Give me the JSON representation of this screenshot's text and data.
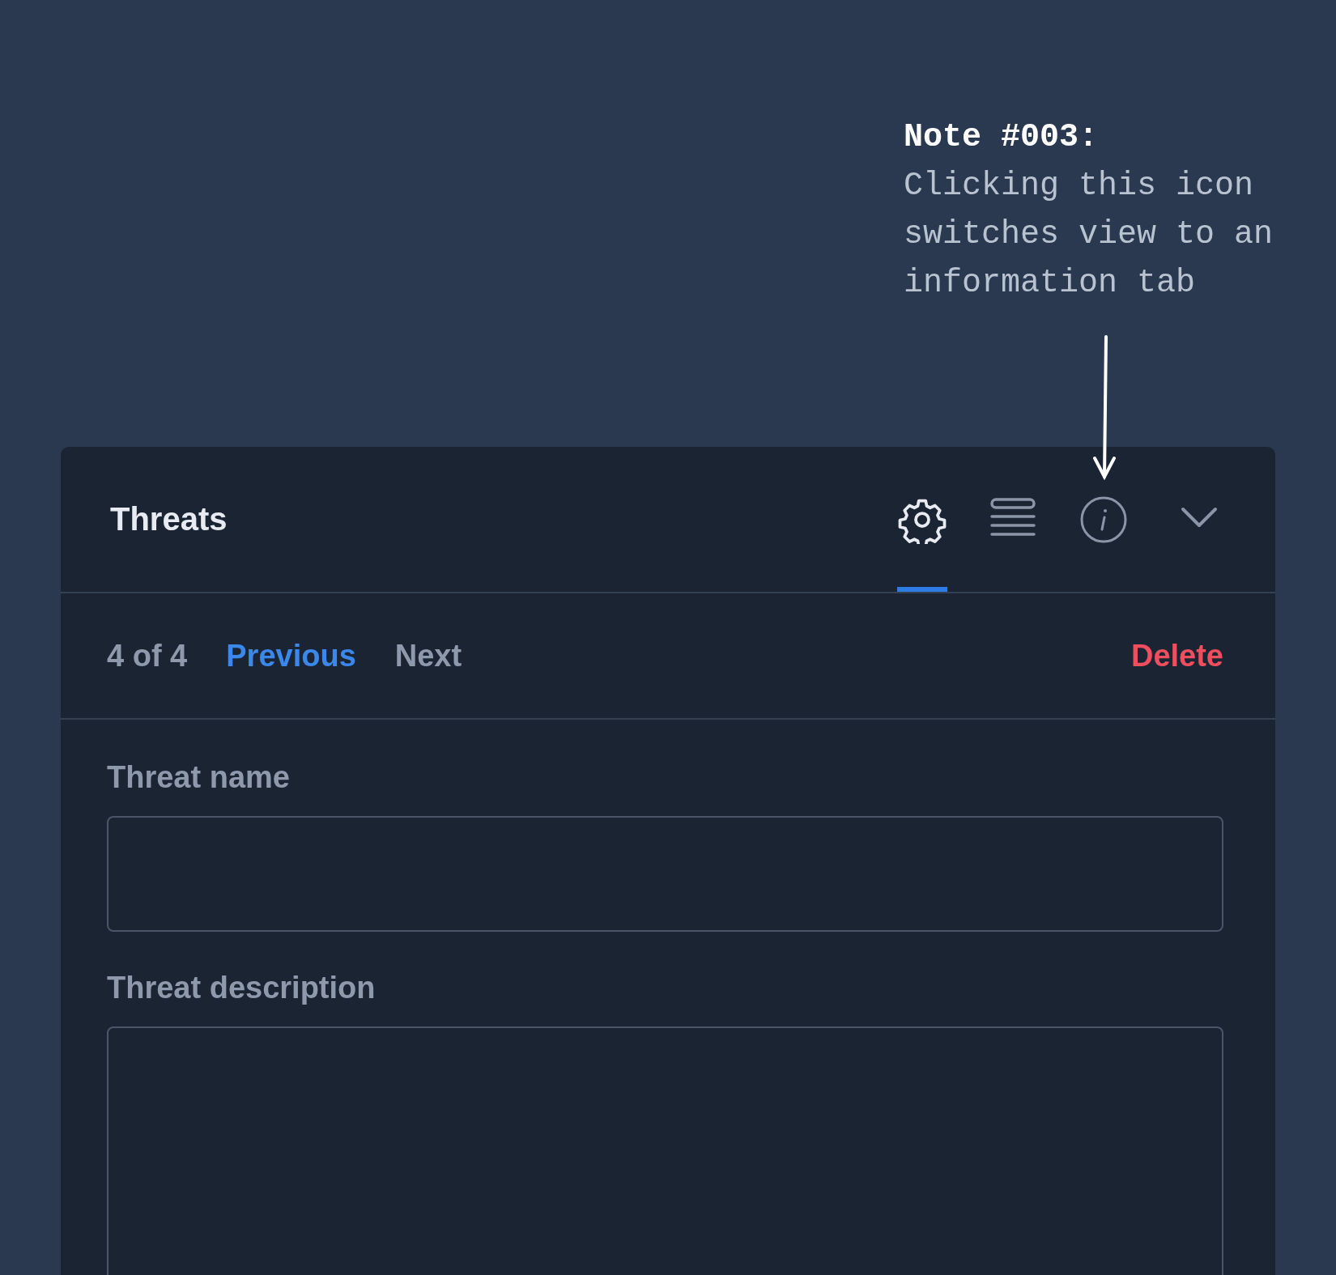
{
  "note": {
    "heading": "Note #003:",
    "body": "Clicking this icon switches view to an information tab"
  },
  "panel": {
    "title": "Threats",
    "tabs": [
      {
        "kind": "gear",
        "selected": true
      },
      {
        "kind": "list",
        "selected": false
      },
      {
        "kind": "info",
        "selected": false
      }
    ],
    "expanded": true,
    "pager": {
      "count": "4 of 4",
      "previous": {
        "label": "Previous",
        "disabled": false
      },
      "next": {
        "label": "Next",
        "disabled": true
      },
      "delete": "Delete"
    },
    "fields": [
      {
        "label": "Threat name",
        "kind": "input"
      },
      {
        "label": "Threat description",
        "kind": "textarea"
      }
    ]
  }
}
